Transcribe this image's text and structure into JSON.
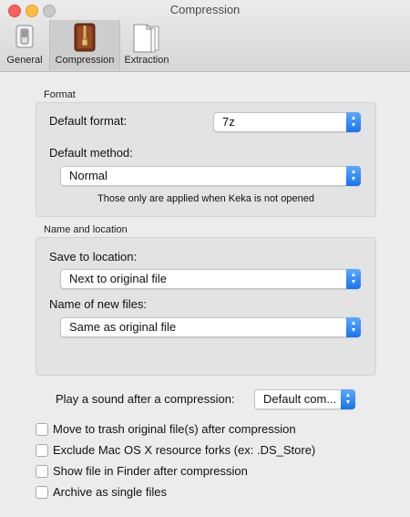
{
  "window": {
    "title": "Compression"
  },
  "toolbar": {
    "tabs": [
      {
        "label": "General",
        "icon": "toggle-switch-icon"
      },
      {
        "label": "Compression",
        "icon": "archive-zipper-icon",
        "active": true
      },
      {
        "label": "Extraction",
        "icon": "document-stack-icon"
      }
    ]
  },
  "format": {
    "section_title": "Format",
    "default_format_label": "Default format:",
    "default_format_value": "7z",
    "default_method_label": "Default method:",
    "default_method_value": "Normal",
    "note": "Those only are applied when Keka is not opened"
  },
  "name_location": {
    "section_title": "Name and location",
    "save_to_label": "Save to location:",
    "save_to_value": "Next to original file",
    "name_files_label": "Name of new files:",
    "name_files_value": "Same as original file"
  },
  "sound": {
    "label": "Play a sound after a compression:",
    "value": "Default com..."
  },
  "options": [
    {
      "label": "Move to trash original file(s) after compression",
      "checked": false
    },
    {
      "label": "Exclude Mac OS X resource forks (ex: .DS_Store)",
      "checked": false
    },
    {
      "label": "Show file in Finder after compression",
      "checked": false
    },
    {
      "label": "Archive as single files",
      "checked": false
    }
  ],
  "colors": {
    "accent": "#1a73ea",
    "background": "#ececec"
  }
}
